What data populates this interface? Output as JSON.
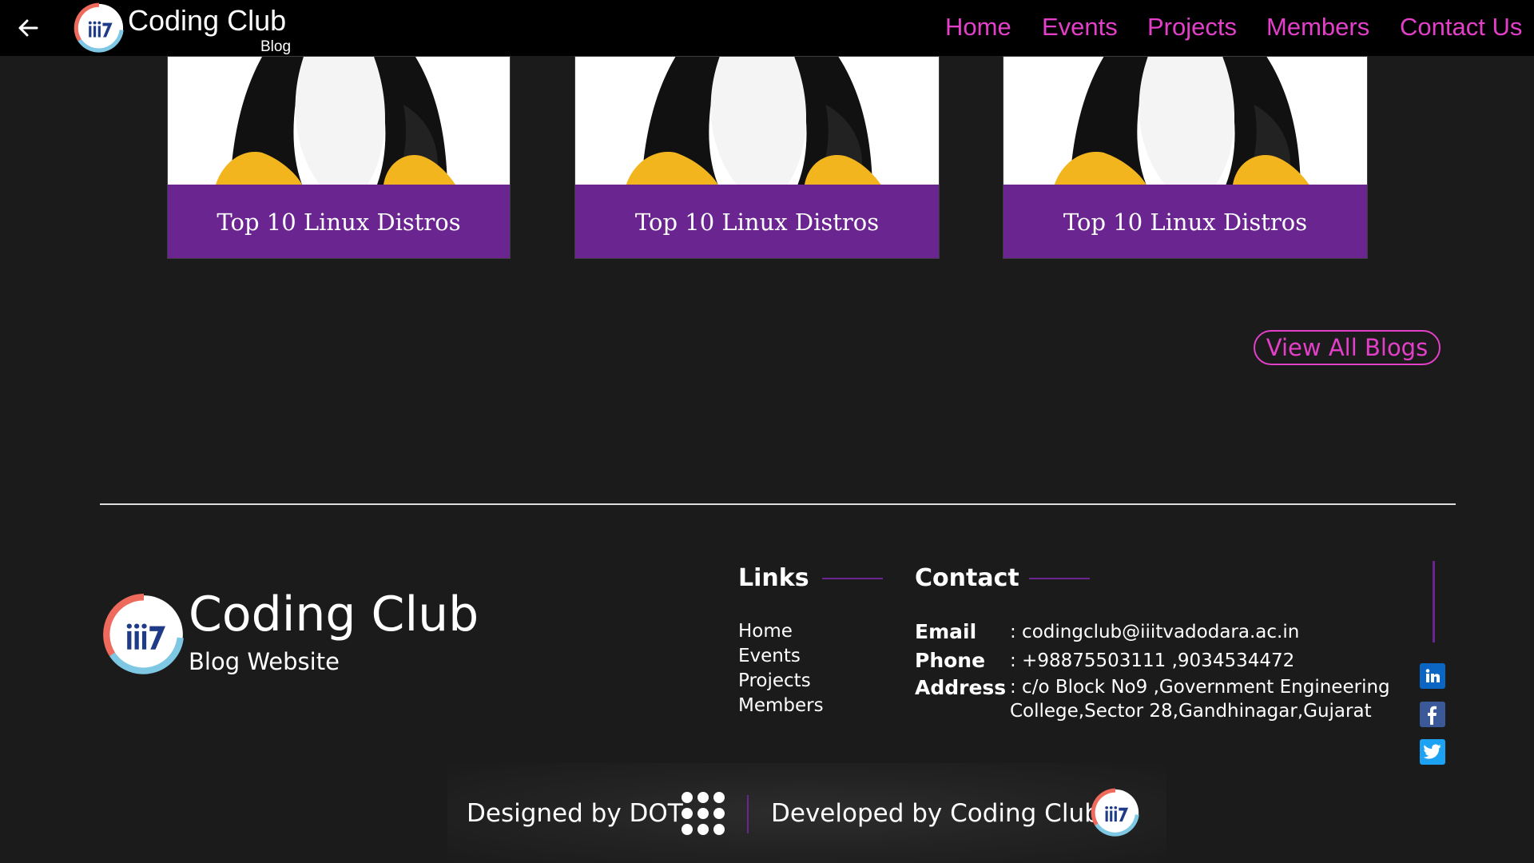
{
  "header": {
    "title": "Coding Club",
    "subtitle": "Blog",
    "nav": [
      "Home",
      "Events",
      "Projects",
      "Members",
      "Contact Us"
    ]
  },
  "blogs": [
    {
      "title": "Top 10 Linux Distros"
    },
    {
      "title": "Top 10 Linux Distros"
    },
    {
      "title": "Top 10 Linux Distros"
    }
  ],
  "view_all_label": "View All Blogs",
  "footer": {
    "brand_title": "Coding Club",
    "brand_subtitle": "Blog Website",
    "links_heading": "Links",
    "links": [
      "Home",
      "Events",
      "Projects",
      "Members"
    ],
    "contact_heading": "Contact",
    "contact": {
      "email_label": "Email",
      "email": ": codingclub@iiitvadodara.ac.in",
      "phone_label": "Phone",
      "phone": ": +98875503111 ,9034534472",
      "address_label": "Address",
      "address_line1": ": c/o Block No9 ,Government Engineering",
      "address_line2": "College,Sector 28,Gandhinagar,Gujarat"
    },
    "social": [
      "linkedin-icon",
      "facebook-icon",
      "twitter-icon"
    ],
    "designed_by": "Designed by DOT",
    "developed_by": "Developed by Coding Club"
  },
  "colors": {
    "accent": "#e43fc9",
    "purple": "#6b2590",
    "background": "#1b1b1b",
    "navbar": "#000000"
  }
}
